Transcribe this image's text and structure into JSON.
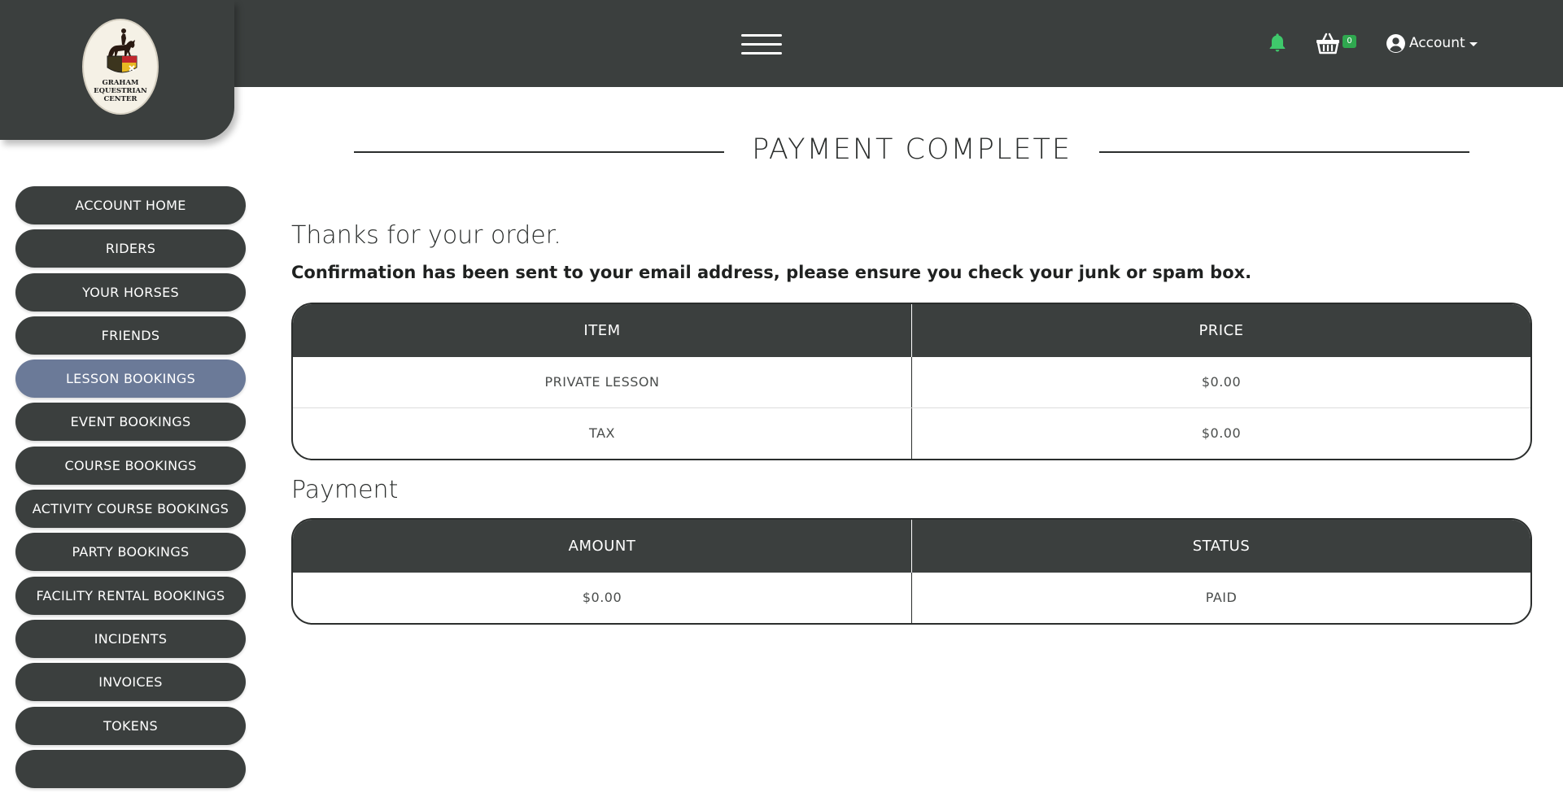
{
  "logo": {
    "lines": [
      "GRAHAM",
      "EQUESTRIAN",
      "CENTER"
    ]
  },
  "header": {
    "menu_icon": "hamburger-menu-icon",
    "notification_icon": "bell-icon",
    "cart_icon": "basket-icon",
    "cart_count": "0",
    "account_label": "Account",
    "colors": {
      "bar": "#3b3f3e",
      "bell": "#3fc86b",
      "badge": "#2fa84f"
    }
  },
  "sidebar": {
    "items": [
      {
        "label": "ACCOUNT HOME"
      },
      {
        "label": "RIDERS"
      },
      {
        "label": "YOUR HORSES"
      },
      {
        "label": "FRIENDS"
      },
      {
        "label": "LESSON BOOKINGS",
        "active": true
      },
      {
        "label": "EVENT BOOKINGS"
      },
      {
        "label": "COURSE BOOKINGS"
      },
      {
        "label": "ACTIVITY COURSE BOOKINGS"
      },
      {
        "label": "PARTY BOOKINGS"
      },
      {
        "label": "FACILITY RENTAL BOOKINGS"
      },
      {
        "label": "INCIDENTS"
      },
      {
        "label": "INVOICES"
      },
      {
        "label": "TOKENS"
      },
      {
        "label": ""
      }
    ],
    "colors": {
      "default": "#3b3f3e",
      "active": "#6b7a98"
    }
  },
  "main": {
    "title": "PAYMENT COMPLETE",
    "thanks": "Thanks for your order.",
    "confirmation": "Confirmation has been sent to your email address, please ensure you check your junk or spam box.",
    "order_table": {
      "headers": [
        "ITEM",
        "PRICE"
      ],
      "rows": [
        [
          "PRIVATE LESSON",
          "$0.00"
        ],
        [
          "TAX",
          "$0.00"
        ]
      ]
    },
    "payment_heading": "Payment",
    "payment_table": {
      "headers": [
        "AMOUNT",
        "STATUS"
      ],
      "rows": [
        [
          "$0.00",
          "PAID"
        ]
      ]
    }
  }
}
